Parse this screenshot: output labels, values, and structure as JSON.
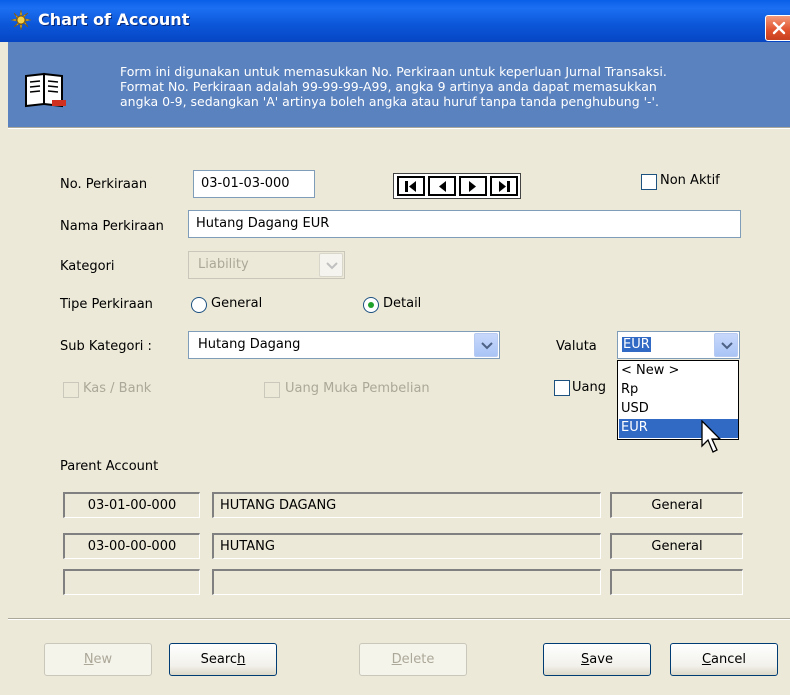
{
  "window": {
    "title": "Chart of Account"
  },
  "banner": {
    "line1": "Form  ini digunakan untuk memasukkan No. Perkiraan untuk keperluan Jurnal Transaksi.",
    "line2": "Format No. Perkiraan adalah 99-99-99-A99, angka 9 artinya anda dapat memasukkan",
    "line3": "angka 0-9, sedangkan 'A' artinya boleh angka atau huruf tanpa tanda penghubung '-'."
  },
  "form": {
    "no_perkiraan_label": "No. Perkiraan",
    "no_perkiraan_value": "03-01-03-000",
    "non_aktif_label": "Non Aktif",
    "nama_perkiraan_label": "Nama Perkiraan",
    "nama_perkiraan_value": "Hutang Dagang EUR",
    "kategori_label": "Kategori",
    "kategori_value": "Liability",
    "tipe_label": "Tipe Perkiraan",
    "tipe_general": "General",
    "tipe_detail": "Detail",
    "sub_kategori_label": "Sub Kategori :",
    "sub_kategori_value": "Hutang Dagang",
    "valuta_label": "Valuta",
    "valuta_value": "EUR",
    "kas_bank_label": "Kas / Bank",
    "uang_muka_pembelian_label": "Uang Muka Pembelian",
    "uang_label": "Uang"
  },
  "valuta_options": [
    "< New >",
    "Rp",
    "USD",
    "EUR"
  ],
  "parent": {
    "label": "Parent Account",
    "rows": [
      {
        "code": "03-01-00-000",
        "name": "HUTANG DAGANG",
        "type": "General"
      },
      {
        "code": "03-00-00-000",
        "name": "HUTANG",
        "type": "General"
      },
      {
        "code": "",
        "name": "",
        "type": ""
      }
    ]
  },
  "buttons": {
    "new_pre": "",
    "new_key": "N",
    "new_post": "ew",
    "search_pre": "Searc",
    "search_key": "h",
    "search_post": "",
    "delete_pre": "",
    "delete_key": "D",
    "delete_post": "elete",
    "save_pre": "",
    "save_key": "S",
    "save_post": "ave",
    "cancel_pre": "",
    "cancel_key": "C",
    "cancel_post": "ancel"
  },
  "colors": {
    "titlebar": "#0A5FE8",
    "banner": "#5A82BE",
    "selection": "#316AC5",
    "dialog": "#ECE9D8"
  }
}
